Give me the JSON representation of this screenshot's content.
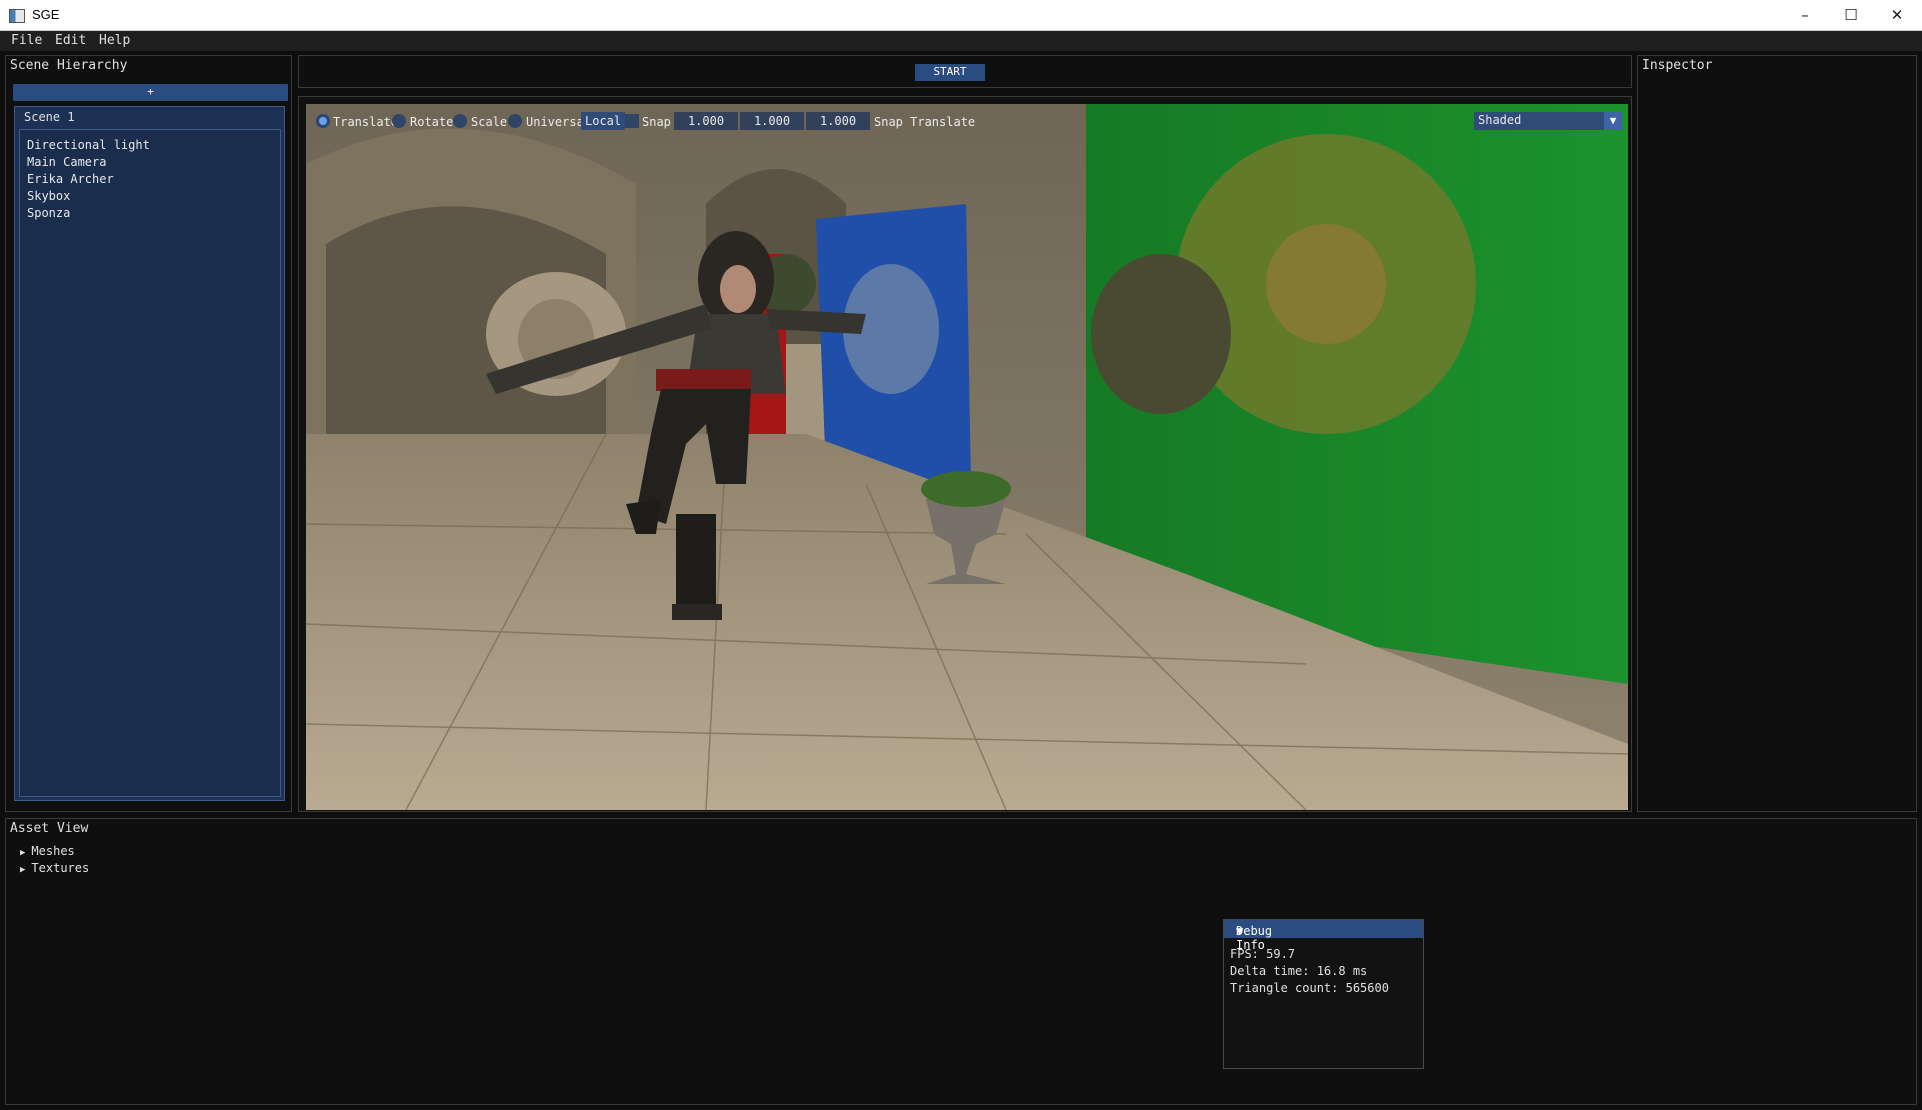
{
  "window": {
    "title": "SGE",
    "minimize": "–",
    "maximize": "☐",
    "close": "✕"
  },
  "menu": [
    "File",
    "Edit",
    "Help"
  ],
  "hierarchy": {
    "title": "Scene Hierarchy",
    "add_label": "+",
    "scene_name": "Scene 1",
    "items": [
      "Directional light",
      "Main Camera",
      "Erika Archer",
      "Skybox",
      "Sponza"
    ]
  },
  "toolbar": {
    "start_label": "START"
  },
  "gizmo": {
    "operations": [
      "Translate",
      "Rotate",
      "Scale",
      "Universal"
    ],
    "selected_operation": "Translate",
    "space": "Local",
    "snap_label": "Snap",
    "snap_values": [
      "1.000",
      "1.000",
      "1.000"
    ],
    "snap_mode": "Snap Translate",
    "shading": "Shaded",
    "dropdown_arrow": "▼"
  },
  "inspector": {
    "title": "Inspector"
  },
  "assets": {
    "title": "Asset View",
    "folders": [
      "Meshes",
      "Textures"
    ],
    "collapsed_arrow": "▶"
  },
  "debug": {
    "title": "Debug Info",
    "toggle_arrow": "▼",
    "fps": "FPS: 59.7",
    "delta": "Delta time: 16.8 ms",
    "triangles": "Triangle count: 565600"
  },
  "colors": {
    "accent": "#2a4c80",
    "panel_bg": "#0f0f0f",
    "hierarchy_bg": "#1d3154",
    "curtain_blue": "#1f4fa8",
    "curtain_green": "#1d8a2a",
    "curtain_red": "#b01818",
    "stone": "#b3a58c"
  }
}
